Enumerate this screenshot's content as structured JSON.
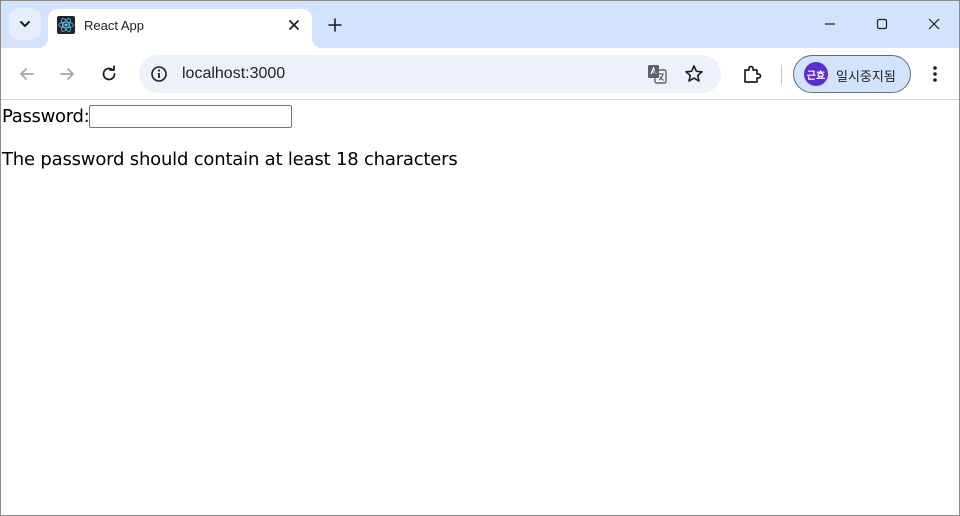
{
  "browser": {
    "tab": {
      "title": "React App"
    },
    "address_bar": {
      "url": "localhost:3000"
    },
    "profile": {
      "avatar_text": "근효",
      "label": "일시중지됨"
    }
  },
  "page": {
    "password_label": "Password:",
    "password_value": "",
    "hint": "The password should contain at least 18 characters"
  },
  "colors": {
    "tabstrip": "#d3e3fd",
    "omnibox": "#edf2fa",
    "avatar": "#5b2bd5"
  }
}
